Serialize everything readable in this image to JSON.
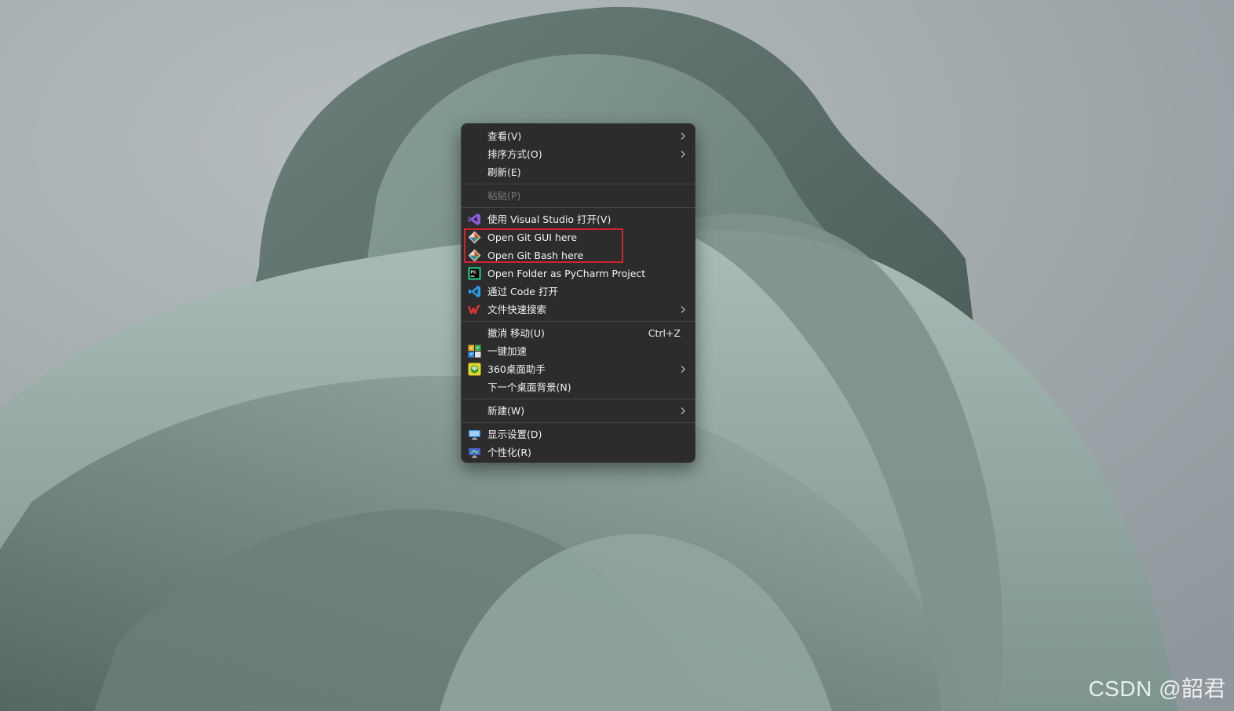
{
  "menu": {
    "groups": [
      [
        {
          "label": "查看(V)",
          "submenu": true
        },
        {
          "label": "排序方式(O)",
          "submenu": true
        },
        {
          "label": "刷新(E)"
        }
      ],
      [
        {
          "label": "粘贴(P)",
          "disabled": true
        }
      ],
      [
        {
          "label": "使用 Visual Studio 打开(V)",
          "icon": "visual-studio-icon"
        },
        {
          "label": "Open Git GUI here",
          "icon": "git-gui-icon"
        },
        {
          "label": "Open Git Bash here",
          "icon": "git-bash-icon"
        },
        {
          "label": "Open Folder as PyCharm Project",
          "icon": "pycharm-icon"
        },
        {
          "label": "通过 Code 打开",
          "icon": "vscode-icon"
        },
        {
          "label": "文件快速搜索",
          "icon": "wps-search-icon",
          "submenu": true
        }
      ],
      [
        {
          "label": "撤消 移动(U)",
          "shortcut": "Ctrl+Z"
        },
        {
          "label": "一键加速",
          "icon": "speedup-icon"
        },
        {
          "label": "360桌面助手",
          "icon": "desktop-assistant-360-icon",
          "submenu": true
        },
        {
          "label": "下一个桌面背景(N)"
        }
      ],
      [
        {
          "label": "新建(W)",
          "submenu": true
        }
      ],
      [
        {
          "label": "显示设置(D)",
          "icon": "display-settings-icon"
        },
        {
          "label": "个性化(R)",
          "icon": "personalize-icon"
        }
      ]
    ]
  },
  "watermark": "CSDN @韶君",
  "colors": {
    "menu_bg": "#2c2c2c",
    "highlight_border": "#d2222d",
    "text": "#f2f2f2",
    "disabled_text": "#7b7b7b"
  }
}
